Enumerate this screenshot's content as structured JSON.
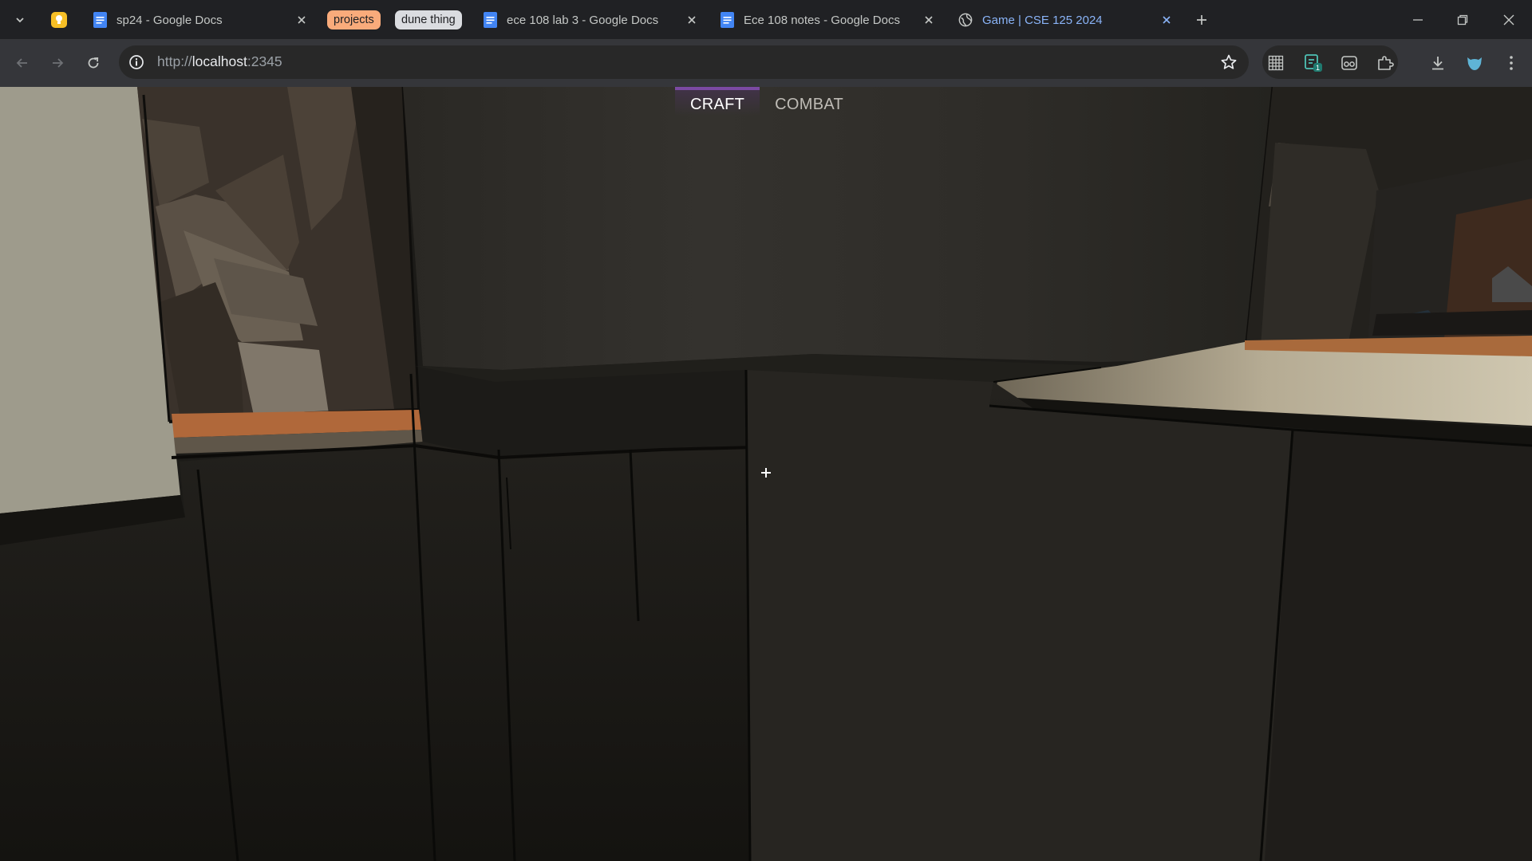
{
  "browser": {
    "tabs": [
      {
        "title": "sp24 - Google Docs",
        "icon": "google-docs-icon",
        "has_close": true
      },
      {
        "title": "ece 108 lab 3 - Google Docs",
        "icon": "google-docs-icon",
        "has_close": true
      },
      {
        "title": "Ece 108 notes - Google Docs",
        "icon": "google-docs-icon",
        "has_close": true
      },
      {
        "title": "Game | CSE 125 2024",
        "icon": "globe-icon",
        "has_close": true,
        "active": true
      }
    ],
    "tab_groups": [
      {
        "label": "projects",
        "color": "#f9ab7b"
      },
      {
        "label": "dune thing",
        "color": "#dadce0"
      }
    ],
    "address_bar": {
      "scheme": "http://",
      "host": "localhost",
      "port": ":2345"
    },
    "colors": {
      "tabstrip": "#202124",
      "toolbar": "#35363a",
      "omnibox": "#282828",
      "active_tab_text": "#8ab4f8",
      "docs_blue": "#4285f4"
    }
  },
  "game": {
    "tabs": [
      {
        "label": "CRAFT",
        "active": true
      },
      {
        "label": "COMBAT",
        "active": false
      }
    ],
    "accent": "#7b4aa3",
    "crosshair": "+"
  }
}
